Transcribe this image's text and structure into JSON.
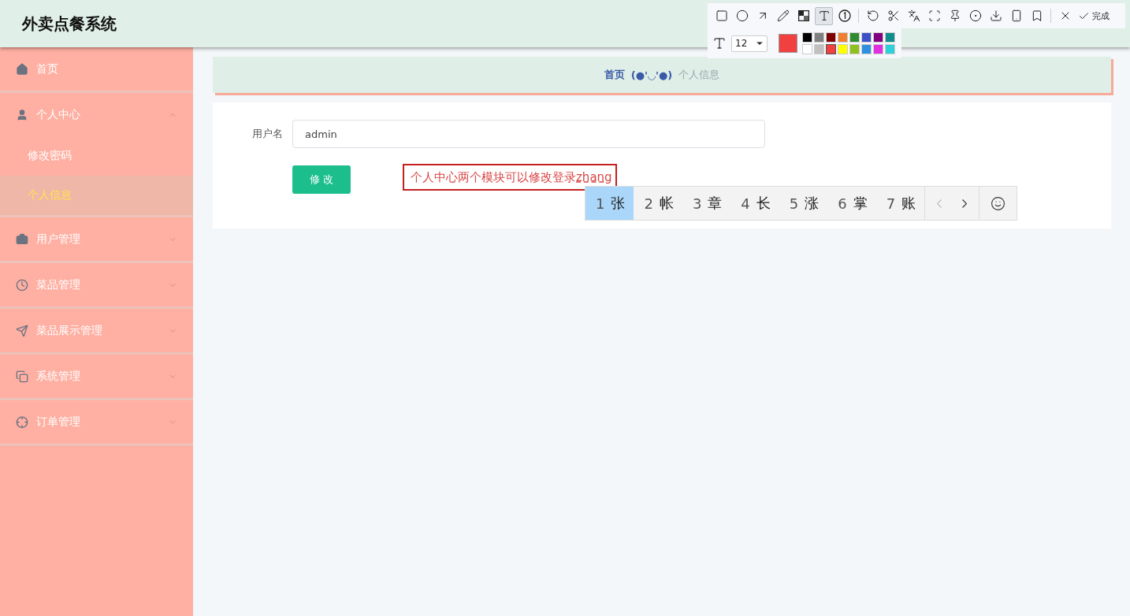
{
  "header": {
    "title": "外卖点餐系统"
  },
  "sidebar": {
    "items": [
      {
        "label": "首页",
        "selected": false
      },
      {
        "label": "个人中心",
        "expanded": true,
        "children": [
          {
            "label": "修改密码",
            "selected": false
          },
          {
            "label": "个人信息",
            "selected": true
          }
        ]
      },
      {
        "label": "用户管理",
        "expanded": false
      },
      {
        "label": "菜品管理",
        "expanded": false
      },
      {
        "label": "菜品展示管理",
        "expanded": false
      },
      {
        "label": "系统管理",
        "expanded": false
      },
      {
        "label": "订单管理",
        "expanded": false
      }
    ]
  },
  "breadcrumb": {
    "home": "首页",
    "separator": "(●'◡'●)",
    "current": "个人信息"
  },
  "form": {
    "fields": [
      {
        "label": "用户名",
        "value": "admin"
      }
    ],
    "submit": "修 改"
  },
  "annotation": {
    "text": "个人中心两个模块可以修改登录",
    "composing": "zhang"
  },
  "ime": {
    "candidates": [
      {
        "number": "1",
        "text": "张",
        "selected": true
      },
      {
        "number": "2",
        "text": "帐",
        "selected": false
      },
      {
        "number": "3",
        "text": "章",
        "selected": false
      },
      {
        "number": "4",
        "text": "长",
        "selected": false
      },
      {
        "number": "5",
        "text": "涨",
        "selected": false
      },
      {
        "number": "6",
        "text": "掌",
        "selected": false
      },
      {
        "number": "7",
        "text": "账",
        "selected": false
      }
    ]
  },
  "capture_toolbar": {
    "tools": [
      {
        "kind": "rect",
        "selected": false
      },
      {
        "kind": "ellipse",
        "selected": false
      },
      {
        "kind": "arrow",
        "selected": false
      },
      {
        "kind": "pencil",
        "selected": false
      },
      {
        "kind": "mosaic",
        "selected": false
      },
      {
        "kind": "text",
        "selected": true
      },
      {
        "kind": "number",
        "selected": false
      },
      {
        "kind": "undo",
        "selected": false
      },
      {
        "kind": "scissors",
        "selected": false
      },
      {
        "kind": "translate",
        "selected": false
      },
      {
        "kind": "scan",
        "selected": false
      },
      {
        "kind": "pin",
        "selected": false
      },
      {
        "kind": "record",
        "selected": false
      },
      {
        "kind": "download",
        "selected": false
      },
      {
        "kind": "phone",
        "selected": false
      },
      {
        "kind": "bookmark",
        "selected": false
      },
      {
        "kind": "close",
        "selected": false
      }
    ],
    "done": "完成",
    "font_size": "12",
    "palette": [
      {
        "color": "#000000",
        "selected": false
      },
      {
        "color": "#808080",
        "selected": false
      },
      {
        "color": "#800000",
        "selected": false
      },
      {
        "color": "#f08030",
        "selected": false
      },
      {
        "color": "#2e8b2e",
        "selected": false
      },
      {
        "color": "#3c50c8",
        "selected": false
      },
      {
        "color": "#800080",
        "selected": false
      },
      {
        "color": "#108c8c",
        "selected": false
      },
      {
        "color": "#ffffff",
        "selected": false
      },
      {
        "color": "#c0c0c0",
        "selected": false
      },
      {
        "color": "#f04040",
        "selected": true
      },
      {
        "color": "#ffff00",
        "selected": false
      },
      {
        "color": "#90c020",
        "selected": false
      },
      {
        "color": "#3090e0",
        "selected": false
      },
      {
        "color": "#e030e0",
        "selected": false
      },
      {
        "color": "#30d0d8",
        "selected": false
      }
    ]
  }
}
